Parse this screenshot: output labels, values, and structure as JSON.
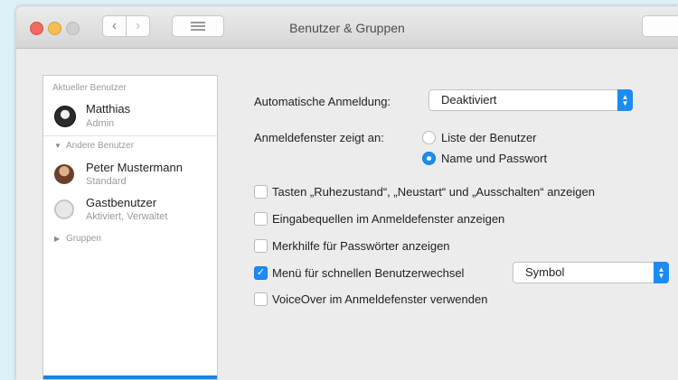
{
  "window": {
    "title": "Benutzer & Gruppen"
  },
  "sidebar": {
    "current_section": "Aktueller Benutzer",
    "current_user": {
      "name": "Matthias",
      "role": "Admin"
    },
    "others_section": "Andere Benutzer",
    "other_users": [
      {
        "name": "Peter Mustermann",
        "role": "Standard"
      },
      {
        "name": "Gastbenutzer",
        "role": "Aktiviert, Verwaltet"
      }
    ],
    "groups_label": "Gruppen"
  },
  "login": {
    "auto_login_label": "Automatische Anmeldung:",
    "auto_login_value": "Deaktiviert",
    "window_shows_label": "Anmeldefenster zeigt an:",
    "radio_options": [
      {
        "label": "Liste der Benutzer",
        "selected": false
      },
      {
        "label": "Name und Passwort",
        "selected": true
      }
    ],
    "checkboxes": [
      {
        "label": "Tasten „Ruhezustand“, „Neustart“ und „Ausschalten“ anzeigen",
        "checked": false
      },
      {
        "label": "Eingabequellen im Anmeldefenster anzeigen",
        "checked": false
      },
      {
        "label": "Merkhilfe für Passwörter anzeigen",
        "checked": false
      },
      {
        "label": "Menü für schnellen Benutzerwechsel",
        "checked": true
      },
      {
        "label": "VoiceOver im Anmeldefenster verwenden",
        "checked": false
      }
    ],
    "fast_switch_value": "Symbol"
  },
  "colors": {
    "accent": "#1c8cf2",
    "selection_bar": "#1a82e2"
  }
}
